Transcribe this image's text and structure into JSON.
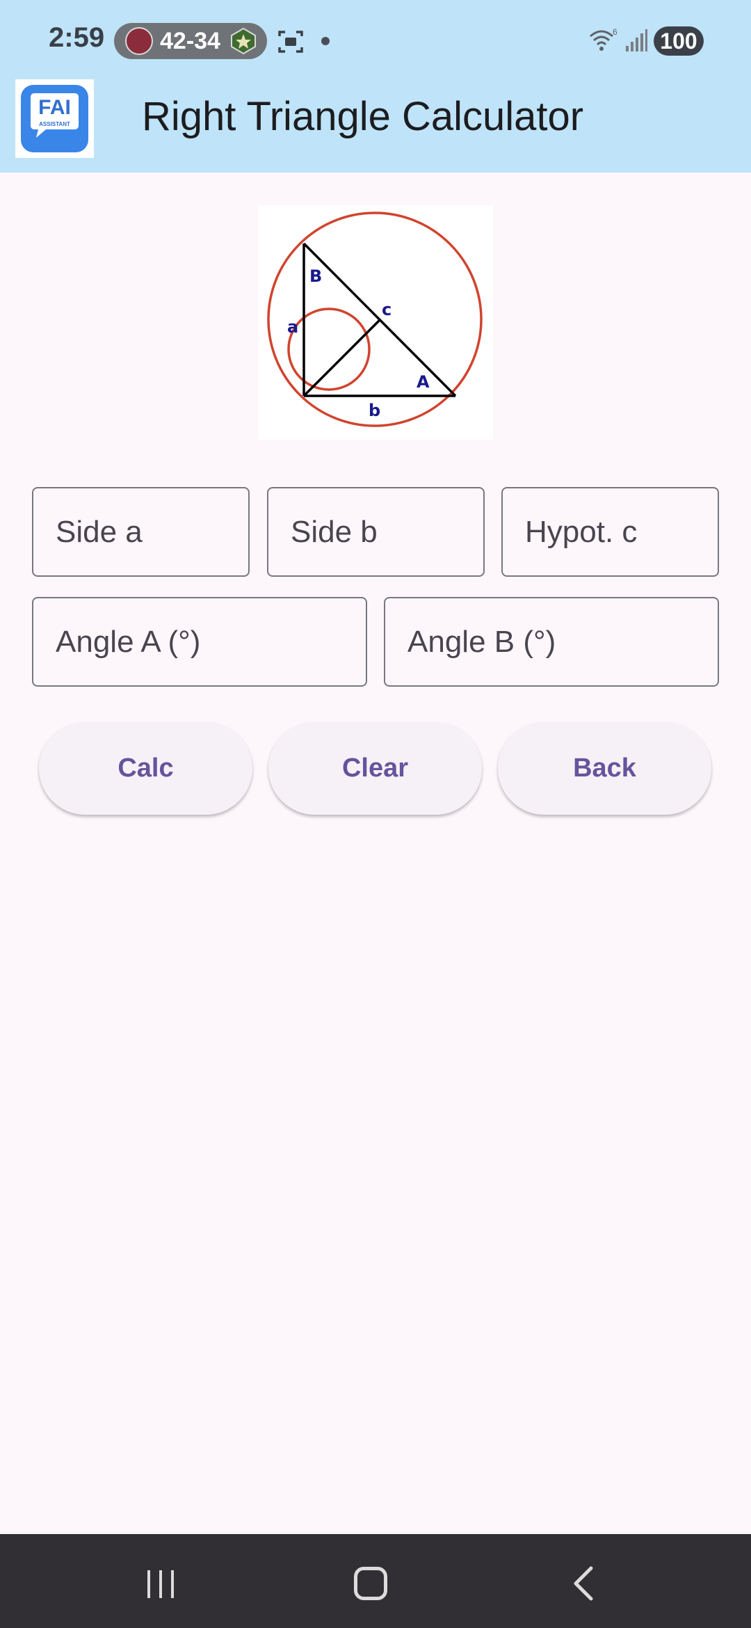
{
  "status_bar": {
    "time": "2:59",
    "score": "42-34",
    "battery": "100",
    "icons": [
      "team-logo-icon",
      "screenshot-icon",
      "notification-dot-icon",
      "wifi-icon",
      "signal-icon",
      "battery-icon"
    ]
  },
  "app_bar": {
    "title": "Right Triangle Calculator",
    "logo_text": "FAI",
    "logo_subtext": "ASSISTANT"
  },
  "diagram": {
    "labels": {
      "angle_B": "B",
      "side_c": "c",
      "side_a": "a",
      "angle_A": "A",
      "side_b": "b"
    },
    "colors": {
      "circle": "#d0442e",
      "lines": "#000000",
      "labels": "#1a1a8c"
    }
  },
  "inputs": {
    "side_a": {
      "placeholder": "Side a",
      "value": ""
    },
    "side_b": {
      "placeholder": "Side b",
      "value": ""
    },
    "hypot_c": {
      "placeholder": "Hypot. c",
      "value": ""
    },
    "angle_a": {
      "placeholder": "Angle A (°)",
      "value": ""
    },
    "angle_b": {
      "placeholder": "Angle B (°)",
      "value": ""
    }
  },
  "buttons": {
    "calc": "Calc",
    "clear": "Clear",
    "back": "Back"
  },
  "colors": {
    "app_bar_bg": "#bfe3f8",
    "page_bg": "#fdf7fc",
    "button_text": "#66539c",
    "nav_bar_bg": "#312f33"
  },
  "nav_bar": {
    "icons": [
      "recents-icon",
      "home-icon",
      "back-icon"
    ]
  }
}
